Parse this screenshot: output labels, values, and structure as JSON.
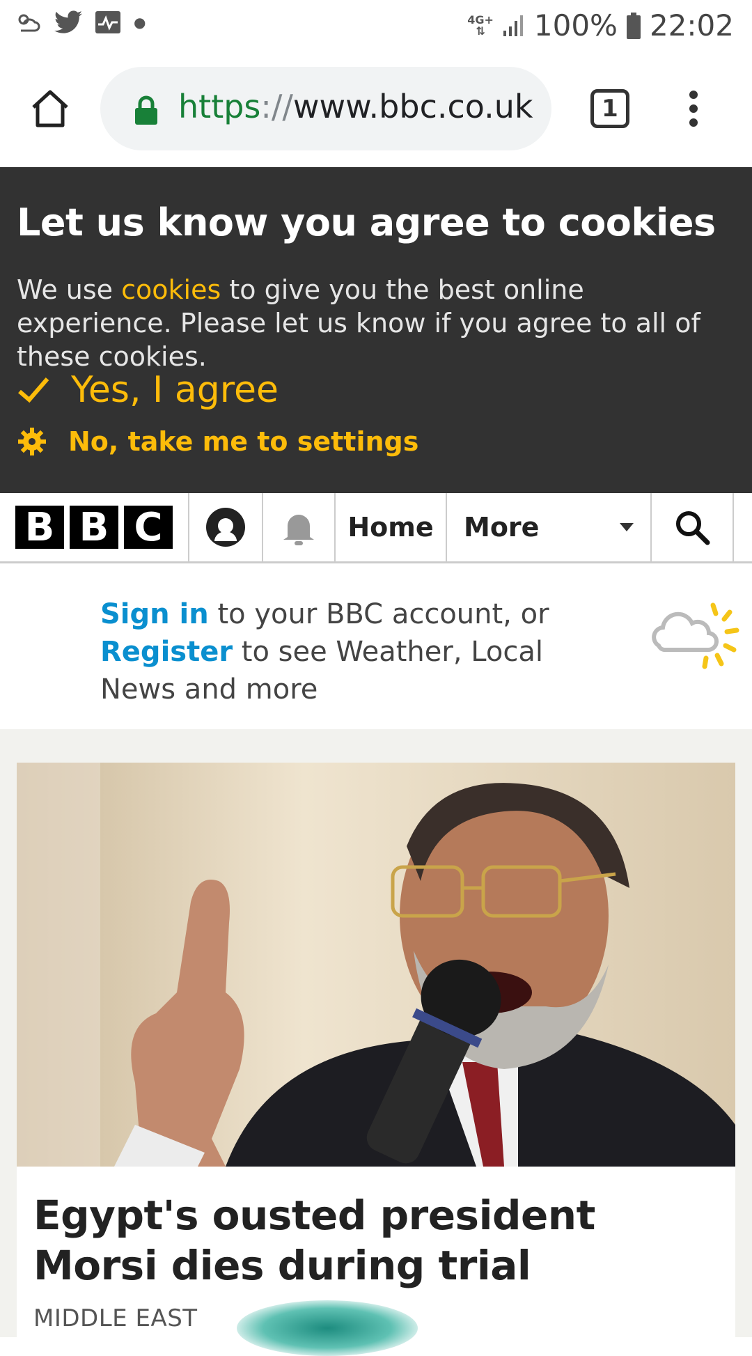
{
  "status_bar": {
    "network": "4G+",
    "battery": "100%",
    "time": "22:02"
  },
  "browser": {
    "url_scheme": "https",
    "url_sep": "://",
    "url_host": "www.bbc.co.uk",
    "tab_count": "1"
  },
  "cookie_banner": {
    "title": "Let us know you agree to cookies",
    "text_before": "We use ",
    "link": "cookies",
    "text_after": " to give you the best online experience. Please let us know if you agree to all of these cookies.",
    "agree_label": "Yes, I agree",
    "settings_label": "No, take me to settings"
  },
  "bbc_nav": {
    "logo_letters": [
      "B",
      "B",
      "C"
    ],
    "home_label": "Home",
    "more_label": "More"
  },
  "signin": {
    "signin_link": "Sign in",
    "text_1": " to your BBC account, or ",
    "register_link": "Register",
    "text_2": " to see Weather, Local News and more"
  },
  "story": {
    "headline": "Egypt's ousted president Morsi dies during trial",
    "section": "MIDDLE EAST"
  },
  "colors": {
    "accent_yellow": "#fdbc0a",
    "link_blue": "#0a8fcf",
    "banner_bg": "#323232",
    "url_green": "#188038"
  }
}
